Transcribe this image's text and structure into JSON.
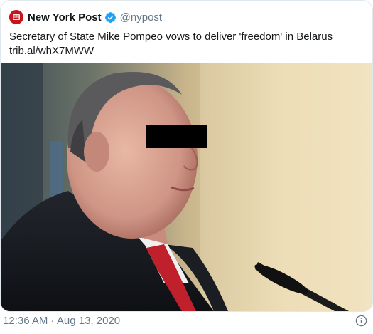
{
  "account": {
    "name": "New York Post",
    "handle": "@nypost",
    "verified": true,
    "brand_color": "#c4161c"
  },
  "tweet": {
    "text": "Secretary of State Mike Pompeo vows to deliver 'freedom' in Belarus",
    "link": "trib.al/whX7MWW"
  },
  "media": {
    "description_icon": "photo"
  },
  "footer": {
    "timestamp": "12:36 AM · Aug 13, 2020",
    "info_icon": "info-icon"
  },
  "colors": {
    "text": "#14171a",
    "secondary": "#657786",
    "verified": "#1da1f2",
    "border": "#e1e8ed"
  }
}
